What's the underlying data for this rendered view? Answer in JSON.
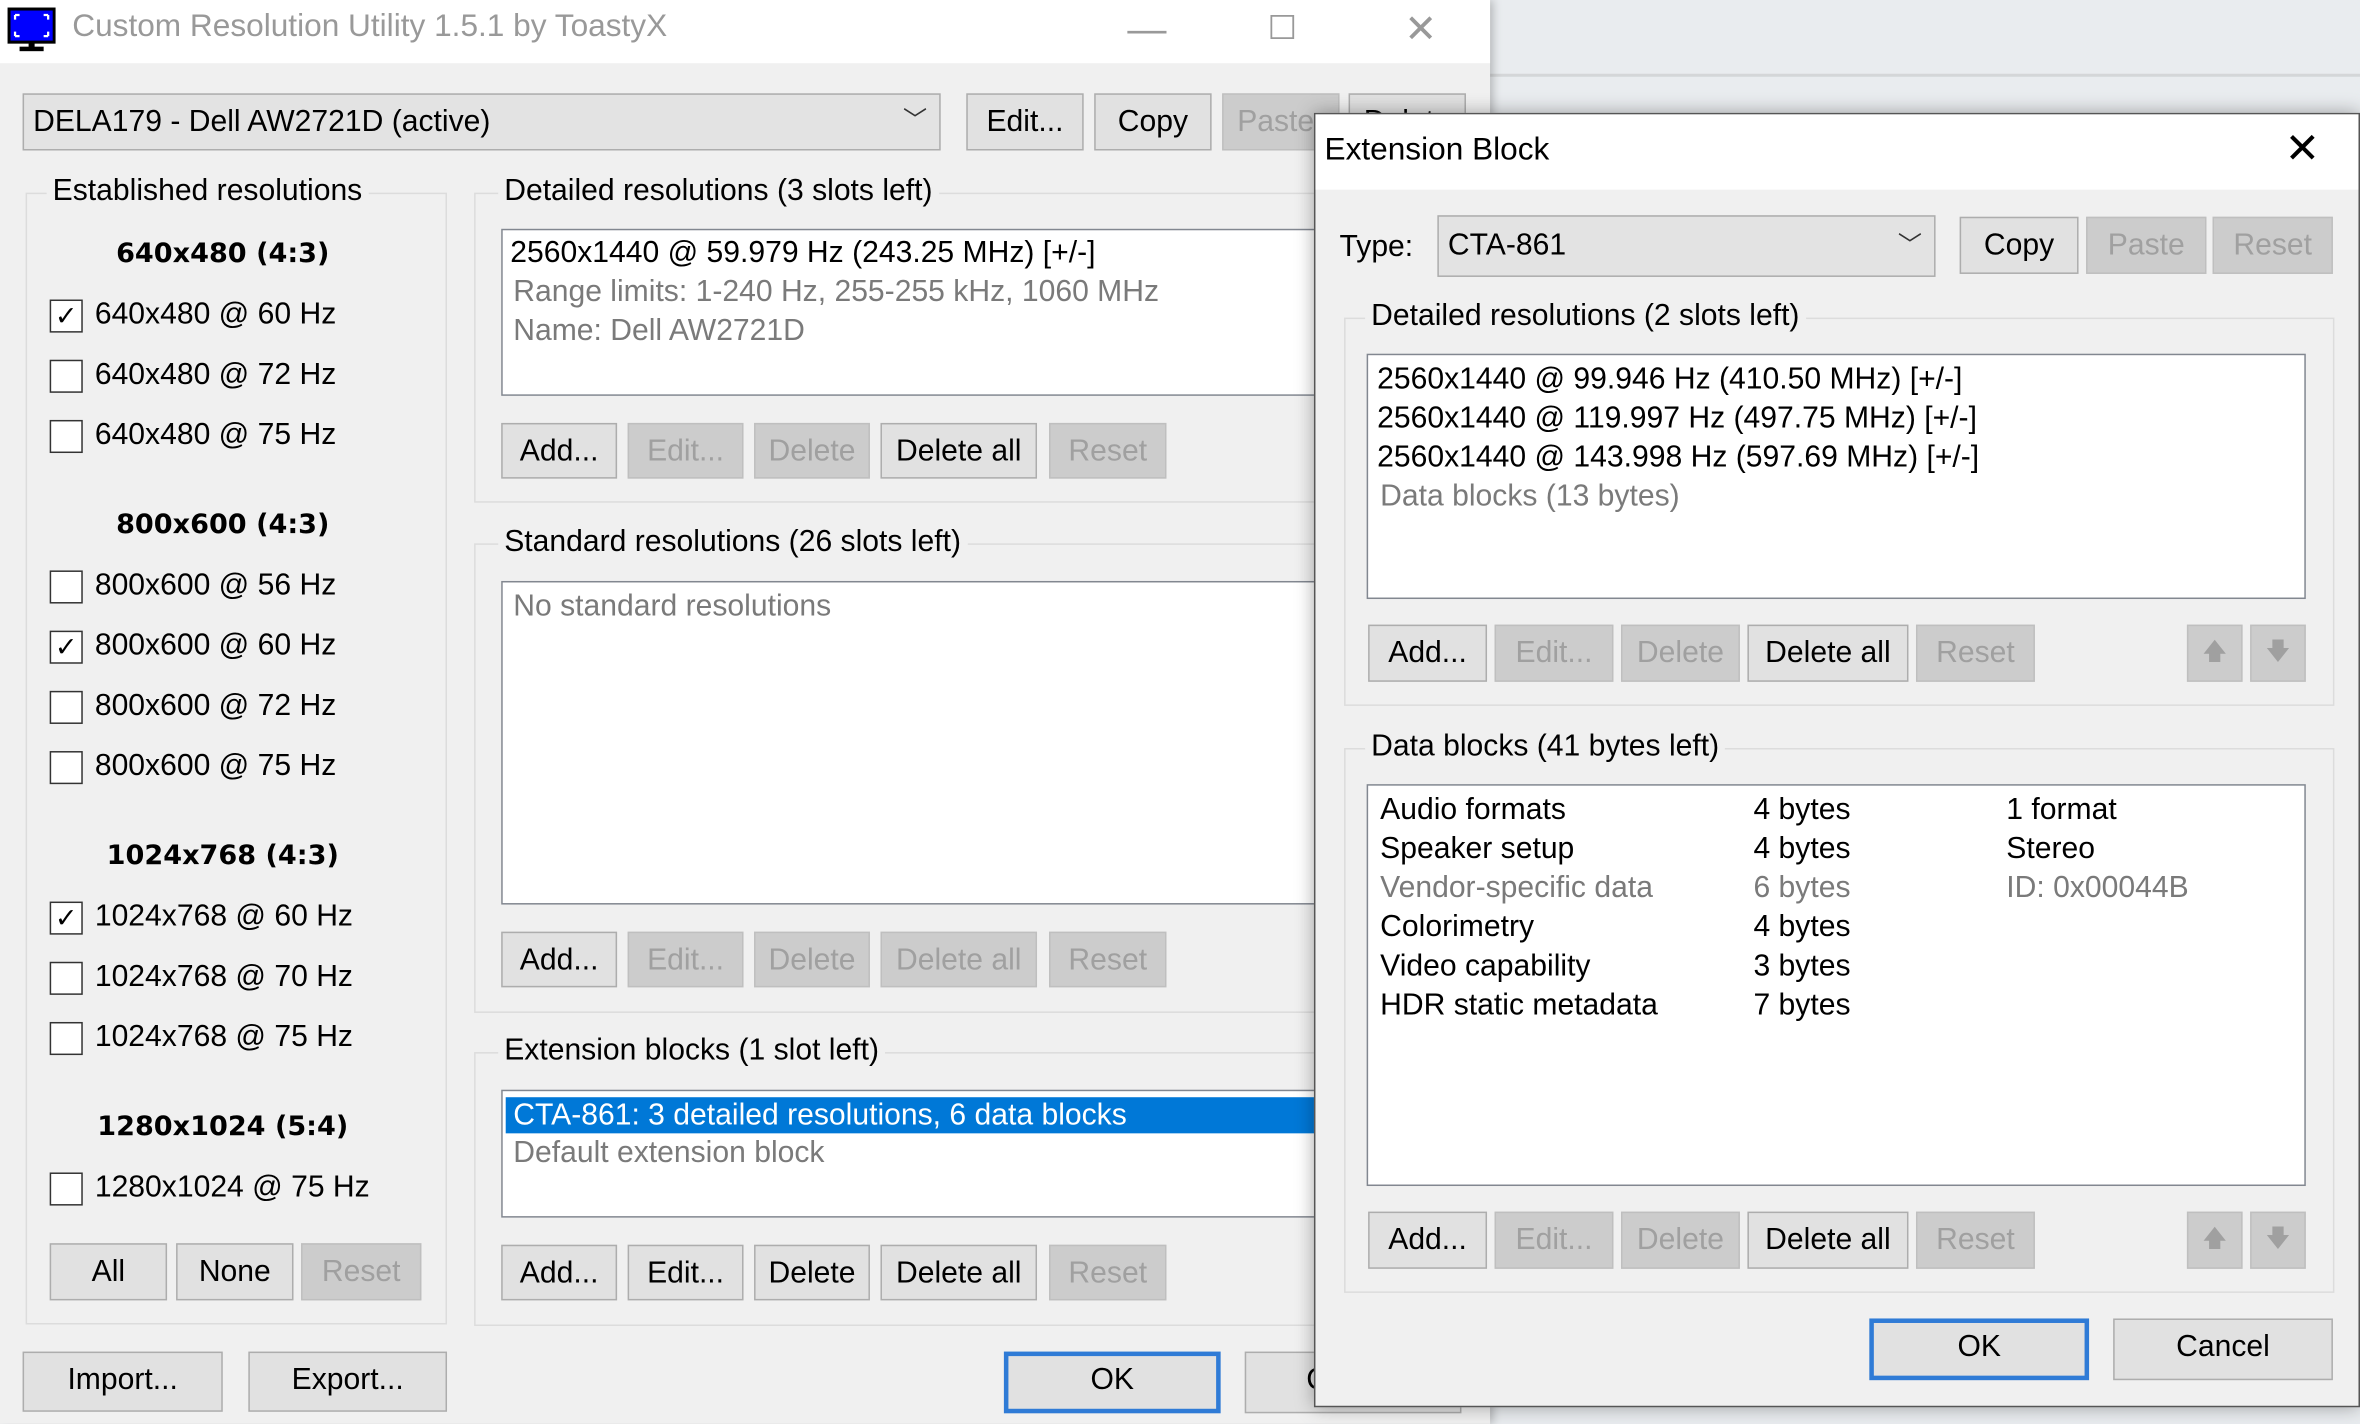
{
  "main": {
    "title": "Custom Resolution Utility 1.5.1 by ToastyX",
    "controls": {
      "minimize": "—",
      "maximize": "☐",
      "close": "✕"
    },
    "monitor": "DELA179 - Dell AW2721D (active)",
    "top_buttons": {
      "edit": "Edit...",
      "copy": "Copy",
      "paste": "Paste",
      "delete": "Delete"
    },
    "established": {
      "label": "Established resolutions",
      "groups": [
        {
          "header": "640x480 (4:3)",
          "items": [
            {
              "label": "640x480 @ 60 Hz",
              "checked": true
            },
            {
              "label": "640x480 @ 72 Hz",
              "checked": false
            },
            {
              "label": "640x480 @ 75 Hz",
              "checked": false
            }
          ]
        },
        {
          "header": "800x600 (4:3)",
          "items": [
            {
              "label": "800x600 @ 56 Hz",
              "checked": false
            },
            {
              "label": "800x600 @ 60 Hz",
              "checked": true
            },
            {
              "label": "800x600 @ 72 Hz",
              "checked": false
            },
            {
              "label": "800x600 @ 75 Hz",
              "checked": false
            }
          ]
        },
        {
          "header": "1024x768 (4:3)",
          "items": [
            {
              "label": "1024x768 @ 60 Hz",
              "checked": true
            },
            {
              "label": "1024x768 @ 70 Hz",
              "checked": false
            },
            {
              "label": "1024x768 @ 75 Hz",
              "checked": false
            }
          ]
        },
        {
          "header": "1280x1024 (5:4)",
          "items": [
            {
              "label": "1280x1024 @ 75 Hz",
              "checked": false
            }
          ]
        }
      ],
      "buttons": {
        "all": "All",
        "none": "None",
        "reset": "Reset"
      }
    },
    "detailed": {
      "label": "Detailed resolutions (3 slots left)",
      "items": [
        "2560x1440 @ 59.979 Hz (243.25 MHz) [+/-]",
        "Range limits: 1-240 Hz, 255-255 kHz, 1060 MHz",
        "Name: Dell AW2721D"
      ]
    },
    "standard": {
      "label": "Standard resolutions (26 slots left)",
      "empty": "No standard resolutions"
    },
    "extension": {
      "label": "Extension blocks (1 slot left)",
      "items": [
        "CTA-861: 3 detailed resolutions, 6 data blocks",
        "Default extension block"
      ]
    },
    "list_buttons": {
      "add": "Add...",
      "edit": "Edit...",
      "delete": "Delete",
      "delete_all": "Delete all",
      "reset": "Reset"
    },
    "import": "Import...",
    "export": "Export...",
    "ok": "OK",
    "cancel": "Cancel"
  },
  "dialog": {
    "title": "Extension Block",
    "close": "✕",
    "type_label": "Type:",
    "type_value": "CTA-861",
    "buttons": {
      "copy": "Copy",
      "paste": "Paste",
      "reset": "Reset"
    },
    "detailed": {
      "label": "Detailed resolutions (2 slots left)",
      "items": [
        "2560x1440 @ 99.946 Hz (410.50 MHz) [+/-]",
        "2560x1440 @ 119.997 Hz (497.75 MHz) [+/-]",
        "2560x1440 @ 143.998 Hz (597.69 MHz) [+/-]",
        "Data blocks (13 bytes)"
      ]
    },
    "data_blocks": {
      "label": "Data blocks (41 bytes left)",
      "rows": [
        {
          "name": "Audio formats",
          "size": "4 bytes",
          "info": "1 format",
          "disabled": false
        },
        {
          "name": "Speaker setup",
          "size": "4 bytes",
          "info": "Stereo",
          "disabled": false
        },
        {
          "name": "Vendor-specific data",
          "size": "6 bytes",
          "info": "ID: 0x00044B",
          "disabled": true
        },
        {
          "name": "Colorimetry",
          "size": "4 bytes",
          "info": "",
          "disabled": false
        },
        {
          "name": "Video capability",
          "size": "3 bytes",
          "info": "",
          "disabled": false
        },
        {
          "name": "HDR static metadata",
          "size": "7 bytes",
          "info": "",
          "disabled": false
        }
      ]
    },
    "list_buttons": {
      "add": "Add...",
      "edit": "Edit...",
      "delete": "Delete",
      "delete_all": "Delete all",
      "reset": "Reset",
      "up": "🡅",
      "down": "🡇"
    },
    "ok": "OK",
    "cancel": "Cancel"
  },
  "colors": {
    "selection": "#0078d7",
    "default_button_border": "#2f7bd6",
    "window_bg": "#f0f0f0"
  }
}
